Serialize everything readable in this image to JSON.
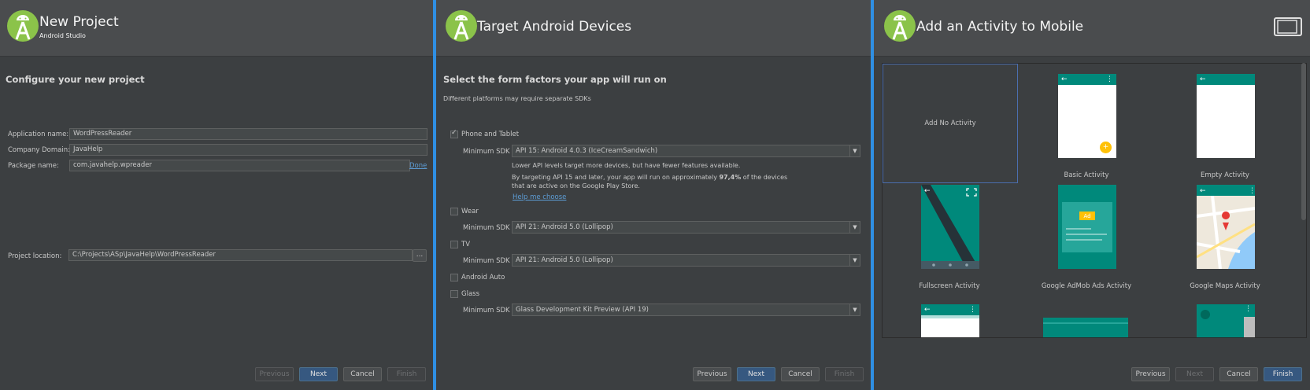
{
  "panel1": {
    "title": "New Project",
    "subtitle": "Android Studio",
    "section_title": "Configure your new project",
    "fields": {
      "app_name_label": "Application name:",
      "app_name_value": "WordPressReader",
      "company_label": "Company Domain:",
      "company_value": "JavaHelp",
      "package_label": "Package name:",
      "package_value": "com.javahelp.wpreader",
      "package_action": "Done",
      "location_label": "Project location:",
      "location_value": "C:\\Projects\\ASp\\JavaHelp\\WordPressReader",
      "browse_label": "..."
    },
    "buttons": {
      "previous": "Previous",
      "next": "Next",
      "cancel": "Cancel",
      "finish": "Finish"
    }
  },
  "panel2": {
    "title": "Target Android Devices",
    "section_title": "Select the form factors your app will run on",
    "section_sub": "Different platforms may require separate SDKs",
    "phone": {
      "label": "Phone and Tablet",
      "checked": true,
      "min_sdk_label": "Minimum SDK",
      "min_sdk_value": "API 15: Android 4.0.3 (IceCreamSandwich)"
    },
    "note1": "Lower API levels target more devices, but have fewer features available.",
    "note2a": "By targeting API 15 and later, your app will run on approximately ",
    "note2b": "97,4%",
    "note2c": " of the devices",
    "note3": "that are active on the Google Play Store.",
    "help_link": "Help me choose",
    "wear": {
      "label": "Wear",
      "min_sdk_label": "Minimum SDK",
      "min_sdk_value": "API 21: Android 5.0 (Lollipop)"
    },
    "tv": {
      "label": "TV",
      "min_sdk_label": "Minimum SDK",
      "min_sdk_value": "API 21: Android 5.0 (Lollipop)"
    },
    "auto": {
      "label": "Android Auto"
    },
    "glass": {
      "label": "Glass",
      "min_sdk_label": "Minimum SDK",
      "min_sdk_value": "Glass Development Kit Preview (API 19)"
    },
    "buttons": {
      "previous": "Previous",
      "next": "Next",
      "cancel": "Cancel",
      "finish": "Finish"
    }
  },
  "panel3": {
    "title": "Add an Activity to Mobile",
    "activities": [
      "Add No Activity",
      "Basic Activity",
      "Empty Activity",
      "Fullscreen Activity",
      "Google AdMob Ads Activity",
      "Google Maps Activity"
    ],
    "ad_badge": "Ad",
    "buttons": {
      "previous": "Previous",
      "next": "Next",
      "cancel": "Cancel",
      "finish": "Finish"
    }
  },
  "colors": {
    "accent_blue": "#2f8fe3",
    "teal": "#00897b",
    "android_green": "#8bc34a",
    "fab_yellow": "#ffc107"
  }
}
